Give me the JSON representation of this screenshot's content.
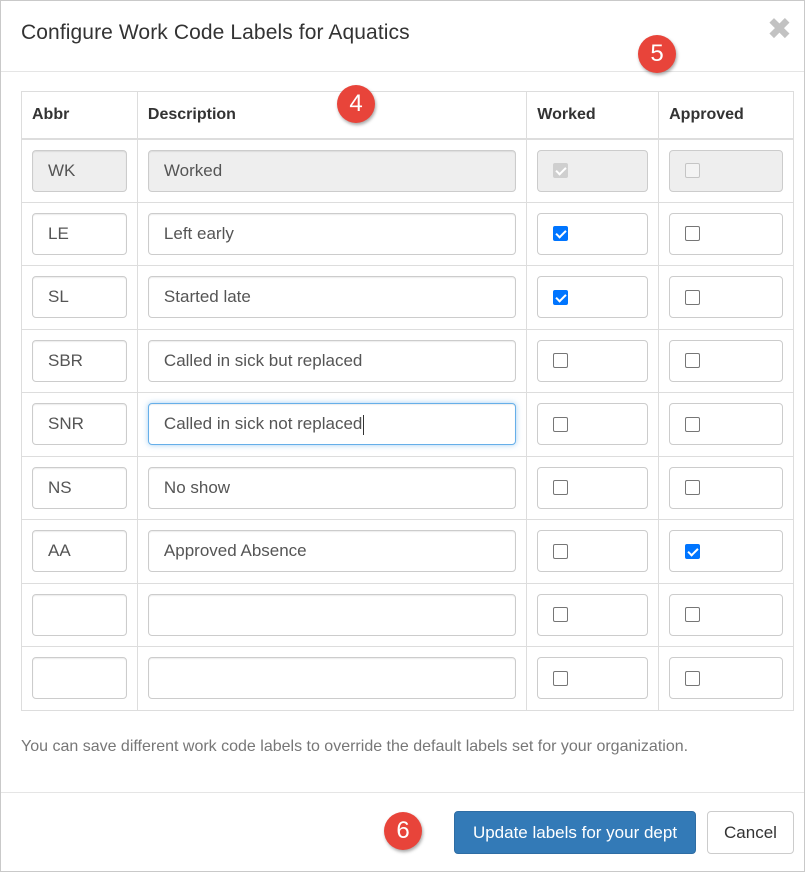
{
  "modal": {
    "title": "Configure Work Code Labels for Aquatics",
    "close_glyph": "✖"
  },
  "badges": [
    "4",
    "5",
    "6"
  ],
  "table": {
    "headers": [
      "Abbr",
      "Description",
      "Worked",
      "Approved"
    ],
    "rows": [
      {
        "abbr": "WK",
        "description": "Worked",
        "worked": true,
        "approved": false,
        "disabled": true
      },
      {
        "abbr": "LE",
        "description": "Left early",
        "worked": true,
        "approved": false
      },
      {
        "abbr": "SL",
        "description": "Started late",
        "worked": true,
        "approved": false
      },
      {
        "abbr": "SBR",
        "description": "Called in sick but replaced",
        "worked": false,
        "approved": false
      },
      {
        "abbr": "SNR",
        "description": "Called in sick not replaced",
        "worked": false,
        "approved": false,
        "focused": true
      },
      {
        "abbr": "NS",
        "description": "No show",
        "worked": false,
        "approved": false
      },
      {
        "abbr": "AA",
        "description": "Approved Absence",
        "worked": false,
        "approved": true
      },
      {
        "abbr": "",
        "description": "",
        "worked": false,
        "approved": false
      },
      {
        "abbr": "",
        "description": "",
        "worked": false,
        "approved": false
      }
    ]
  },
  "note": "You can save different work code labels to override the default labels set for your organization.",
  "footer": {
    "update_label": "Update labels for your dept",
    "cancel_label": "Cancel"
  },
  "colors": {
    "primary": "#337ab7",
    "checkbox_checked": "#0075ff",
    "badge": "#e8443a",
    "focus": "#66afe9"
  }
}
